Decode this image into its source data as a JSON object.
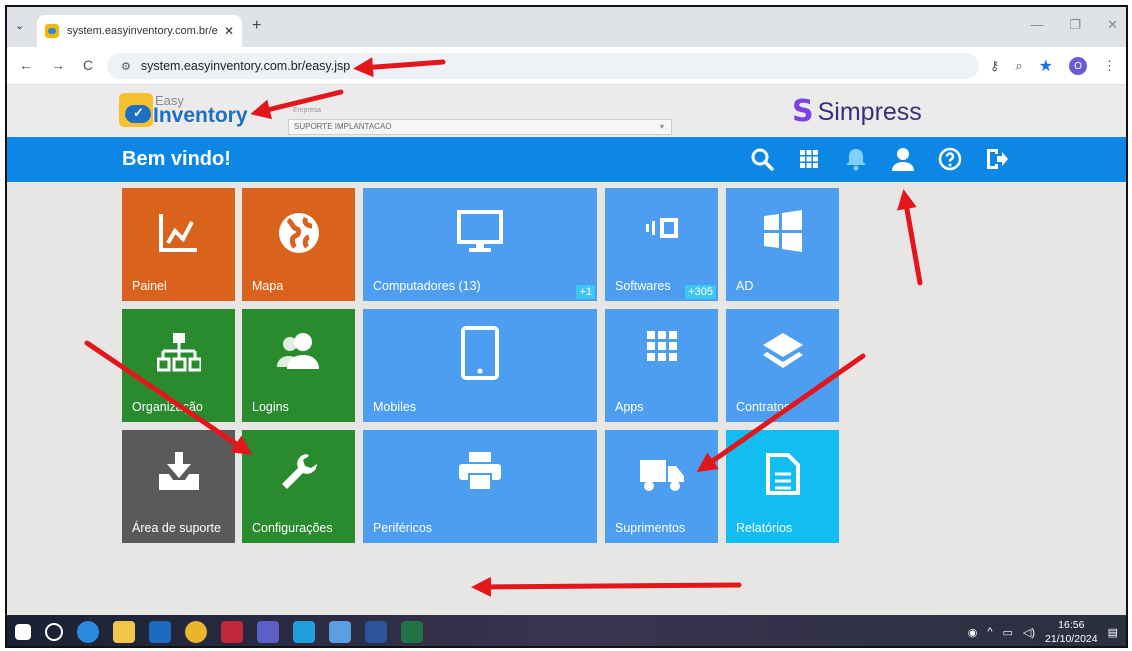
{
  "browser": {
    "tab_title": "system.easyinventory.com.br/e",
    "tab_close": "✕",
    "new_tab": "+",
    "url": "system.easyinventory.com.br/easy.jsp"
  },
  "header": {
    "logo_line1": "Easy",
    "logo_line2": "Inventory",
    "empresa_label": "Empresa",
    "empresa_value": "SUPORTE IMPLANTACAO",
    "brand": "Simpress"
  },
  "bar": {
    "welcome": "Bem vindo!",
    "icons": [
      "search-icon",
      "apps-grid-icon",
      "bell-icon",
      "user-icon",
      "help-icon",
      "logout-icon"
    ]
  },
  "tiles": {
    "painel": "Painel",
    "mapa": "Mapa",
    "computadores": "Computadores (13)",
    "computadores_badge": "+1",
    "softwares": "Softwares",
    "softwares_badge": "+305",
    "ad": "AD",
    "organizacao": "Organização",
    "logins": "Logins",
    "mobiles": "Mobiles",
    "apps": "Apps",
    "contratos": "Contratos",
    "area_suporte": "Área de suporte",
    "configuracoes": "Configurações",
    "perifericos": "Periféricos",
    "suprimentos": "Suprimentos",
    "relatorios": "Relatórios"
  },
  "colors": {
    "blue_bar": "#0d87e5",
    "tile_blue": "#4d9ef0",
    "tile_orange": "#d9631c",
    "tile_green": "#2a8b2e",
    "tile_gray": "#5a5a5a",
    "tile_cyan": "#12bdf2",
    "annotation_red": "#e3161b"
  },
  "taskbar": {
    "time": "16:56",
    "date": "21/10/2024"
  }
}
